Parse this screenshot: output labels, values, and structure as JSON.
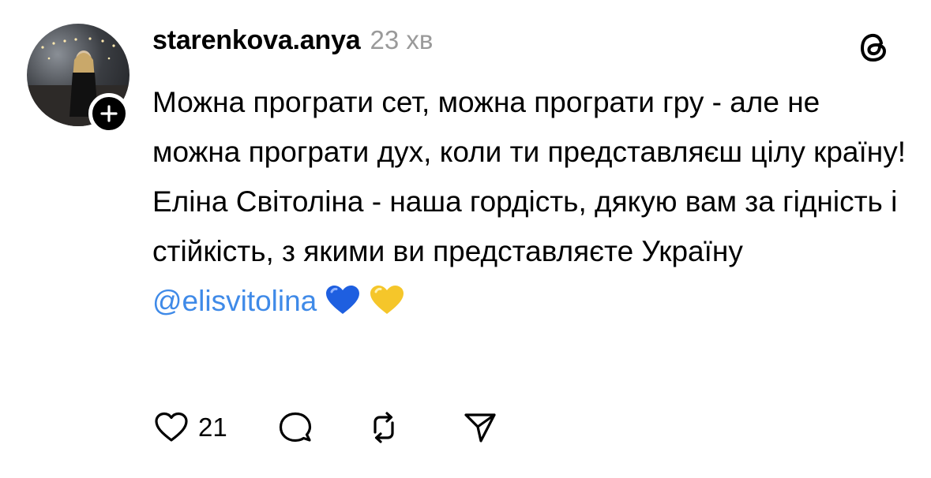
{
  "post": {
    "username": "starenkova.anya",
    "timestamp": "23 хв",
    "paragraphs": [
      "Можна програти сет, можна програти гру - але не можна програти дух, коли ти представляєш цілу країну!",
      "Еліна Світоліна - наша гордість, дякую вам за гідність і стійкість, з якими ви представляєте Україну"
    ],
    "mention": "@elisvitolina",
    "emojis": [
      "blue-heart",
      "yellow-heart"
    ]
  },
  "actions": {
    "like_count": "21"
  },
  "colors": {
    "mention": "#3f8ae8",
    "timestamp": "#9a9a9a",
    "blue_heart": "#1e5fe0",
    "yellow_heart": "#f5c62a"
  }
}
